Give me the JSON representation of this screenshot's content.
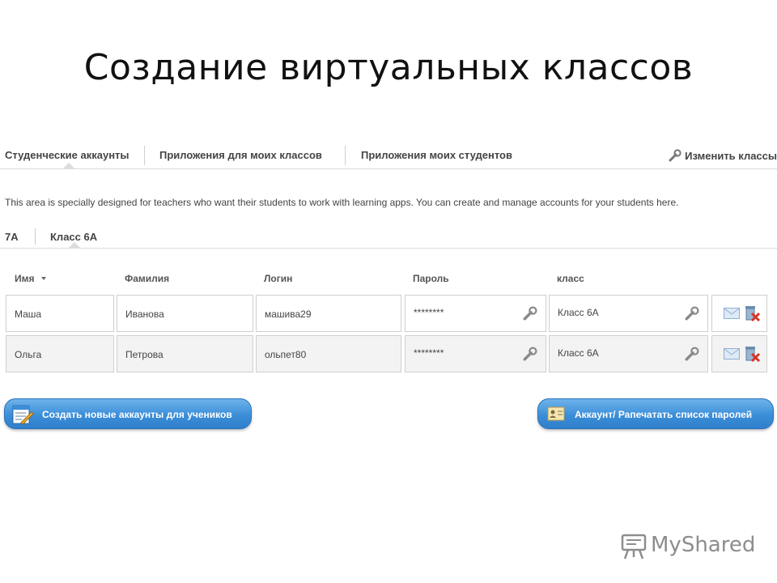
{
  "slide": {
    "title": "Создание виртуальных классов"
  },
  "top_tabs": [
    {
      "label": "Студенческие аккаунты"
    },
    {
      "label": "Приложения для моих классов"
    },
    {
      "label": "Приложения моих студентов"
    }
  ],
  "edit_classes": {
    "label": "Изменить классы",
    "icon": "wrench-icon"
  },
  "info": {
    "text": "This area is specially designed for teachers who want their students to work with learning apps. You can create and manage accounts for your students here."
  },
  "class_tabs": [
    {
      "label": "7А"
    },
    {
      "label": "Класс 6А"
    }
  ],
  "table": {
    "headers": {
      "first_name": "Имя",
      "last_name": "Фамилия",
      "login": "Логин",
      "password": "Пароль",
      "class": "класс"
    },
    "rows": [
      {
        "first_name": "Маша",
        "last_name": "Иванова",
        "login": "машива29",
        "password": "********",
        "class": "Класс 6А"
      },
      {
        "first_name": "Ольга",
        "last_name": "Петрова",
        "login": "ольпет80",
        "password": "********",
        "class": "Класс 6А"
      }
    ]
  },
  "buttons": {
    "create_accounts": "Создать новые аккаунты для учеников",
    "print_passwords": "Аккаунт/ Рапечатать список паролей"
  },
  "watermark": {
    "text": "MyShared"
  },
  "colors": {
    "button_blue": "#3b8ed8",
    "delete_red": "#d9342b"
  }
}
